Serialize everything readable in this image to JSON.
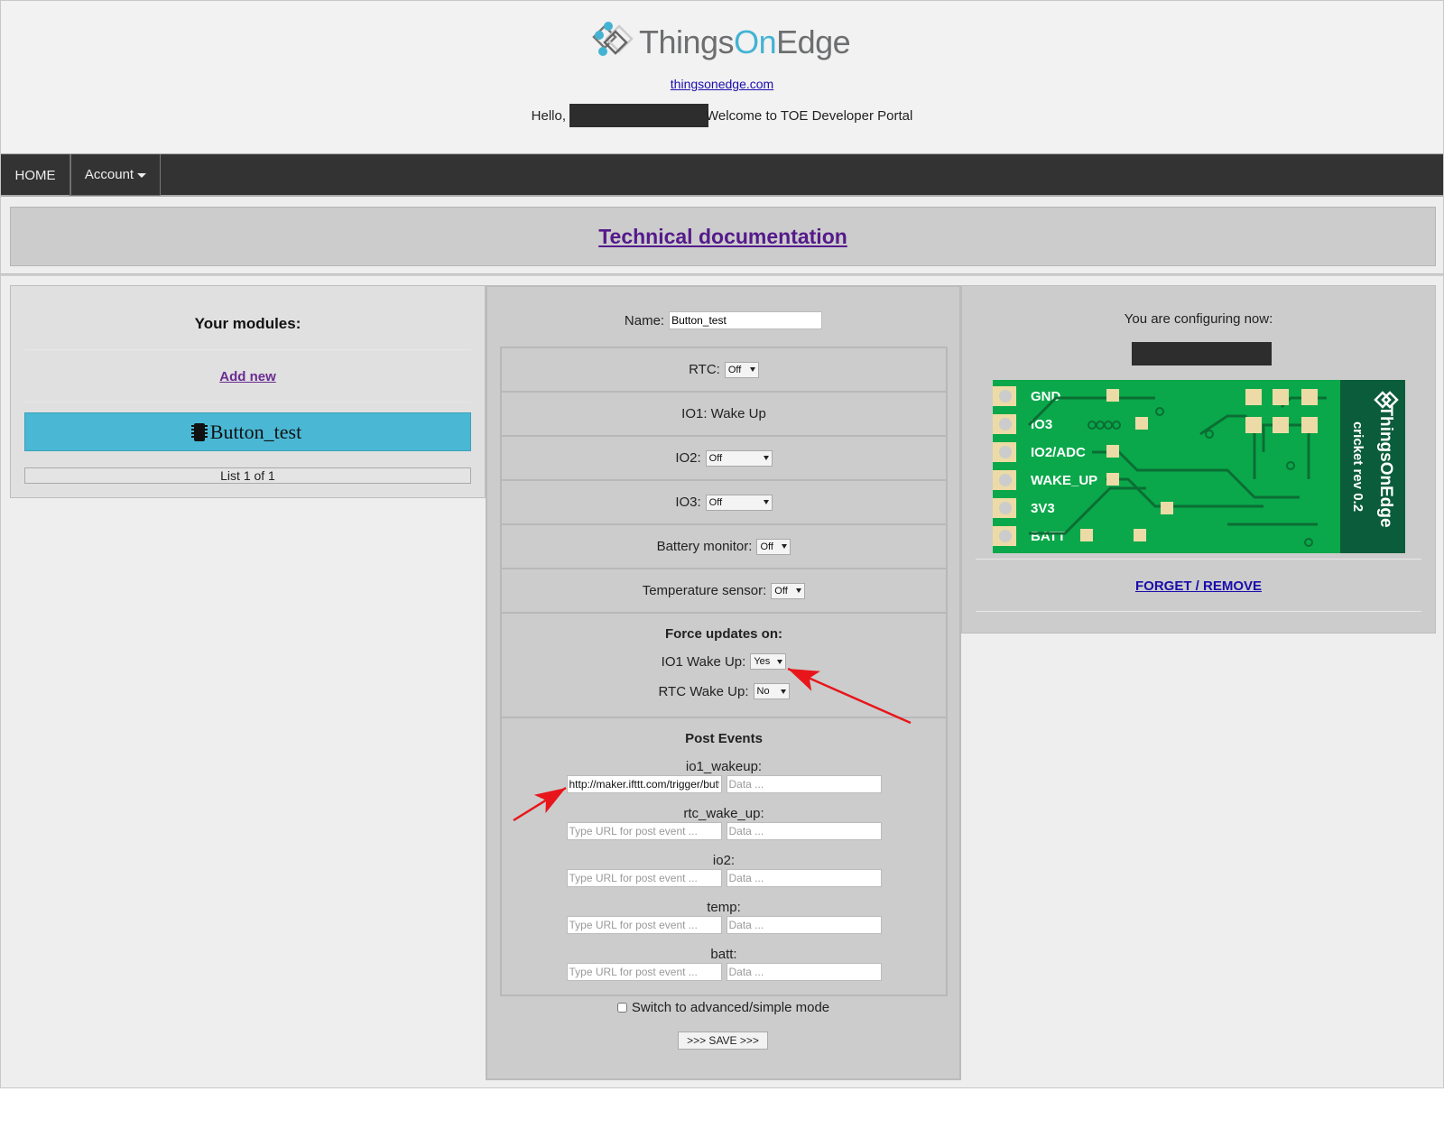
{
  "header": {
    "logo": {
      "text_part1": "Things",
      "text_part2": "On",
      "text_part3": "Edge",
      "icon": "thingsonedge-logo-icon"
    },
    "site_link": "thingsonedge.com",
    "greeting_prefix": "Hello,",
    "greeting_suffix": "Welcome to TOE Developer Portal"
  },
  "nav": {
    "home_label": "HOME",
    "account_label": "Account",
    "account_icon": "caret-down-icon"
  },
  "doc_link": "Technical documentation",
  "modules_panel": {
    "title": "Your modules:",
    "add_new": "Add new",
    "modules": [
      {
        "name": "Button_test",
        "icon": "chip-icon",
        "selected": true
      }
    ],
    "list_count": "List 1 of 1"
  },
  "config_form": {
    "name_label": "Name:",
    "name_value": "Button_test",
    "rtc": {
      "label": "RTC:",
      "value": "Off"
    },
    "io1": {
      "label": "IO1: Wake Up"
    },
    "io2": {
      "label": "IO2:",
      "value": "Off"
    },
    "io3": {
      "label": "IO3:",
      "value": "Off"
    },
    "battery": {
      "label": "Battery monitor:",
      "value": "Off"
    },
    "temperature": {
      "label": "Temperature sensor:",
      "value": "Off"
    },
    "force_updates": {
      "title": "Force updates on:",
      "io1_wake": {
        "label": "IO1 Wake Up:",
        "value": "Yes"
      },
      "rtc_wake": {
        "label": "RTC Wake Up:",
        "value": "No"
      }
    },
    "post_events": {
      "title": "Post Events",
      "url_placeholder": "Type URL for post event ...",
      "data_placeholder": "Data ...",
      "events": [
        {
          "label": "io1_wakeup:",
          "url": "http://maker.ifttt.com/trigger/button",
          "data": ""
        },
        {
          "label": "rtc_wake_up:",
          "url": "",
          "data": ""
        },
        {
          "label": "io2:",
          "url": "",
          "data": ""
        },
        {
          "label": "temp:",
          "url": "",
          "data": ""
        },
        {
          "label": "batt:",
          "url": "",
          "data": ""
        }
      ]
    },
    "mode_toggle_label": "Switch to advanced/simple mode",
    "mode_toggle_checked": false,
    "save_label": ">>> SAVE >>>"
  },
  "device_panel": {
    "title": "You are configuring now:",
    "board": {
      "pins": [
        "GND",
        "IO3",
        "IO2/ADC",
        "WAKE_UP",
        "3V3",
        "BATT"
      ],
      "brand": "ThingsOnEdge",
      "model": "cricket rev 0.2",
      "pcb_color": "#0aa84a",
      "pad_color": "#ecdba6"
    },
    "forget_label": "FORGET / REMOVE"
  },
  "annotations": {
    "arrow_color": "#e8161b"
  }
}
